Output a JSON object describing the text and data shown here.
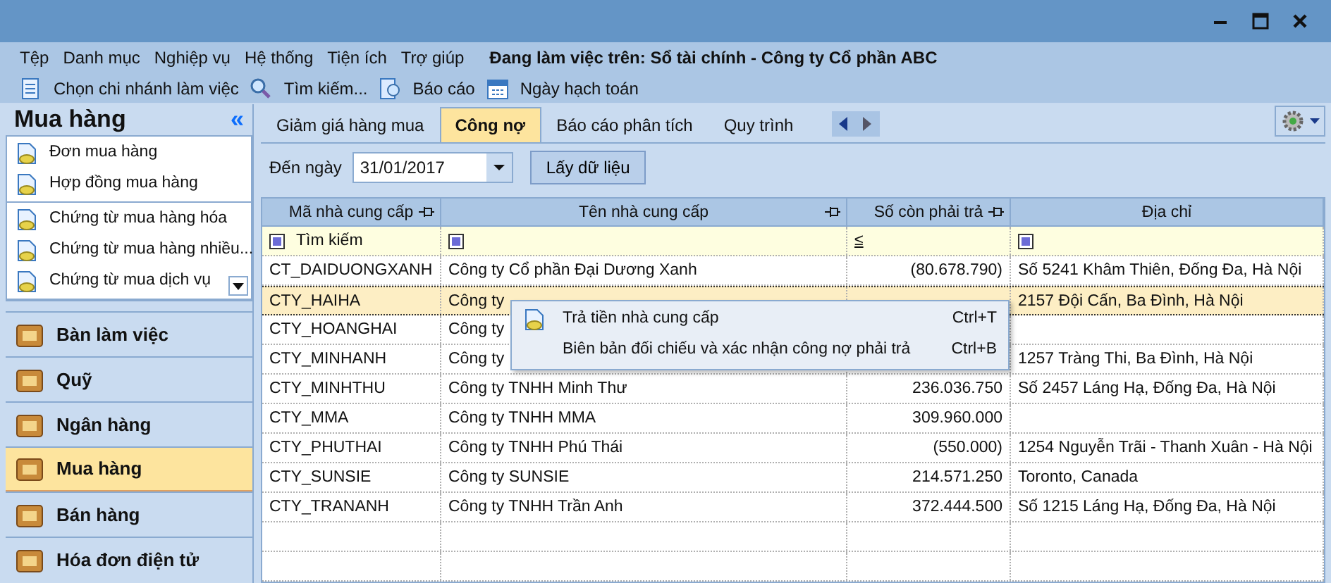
{
  "menu": [
    "Tệp",
    "Danh mục",
    "Nghiệp vụ",
    "Hệ thống",
    "Tiện ích",
    "Trợ giúp"
  ],
  "working_on": "Đang làm việc trên: Sổ tài chính - Công ty Cổ phần ABC",
  "toolbar": [
    {
      "kind": "document",
      "label": "Chọn chi nhánh làm việc"
    },
    {
      "kind": "search",
      "label": "Tìm kiếm..."
    },
    {
      "kind": "report",
      "label": "Báo cáo"
    },
    {
      "kind": "calendar",
      "label": "Ngày hạch toán"
    }
  ],
  "sidebar": {
    "title": "Mua hàng",
    "collapse": "«",
    "groups": [
      [
        "Đơn mua hàng",
        "Hợp đồng mua hàng"
      ],
      [
        "Chứng từ mua hàng hóa",
        "Chứng từ mua hàng nhiều...",
        "Chứng từ mua dịch vụ"
      ]
    ],
    "nav": [
      {
        "label": "Bàn làm việc",
        "selected": false
      },
      {
        "label": "Quỹ",
        "selected": false
      },
      {
        "label": "Ngân hàng",
        "selected": false
      },
      {
        "label": "Mua hàng",
        "selected": true
      },
      {
        "label": "Bán hàng",
        "selected": false
      },
      {
        "label": "Hóa đơn điện tử",
        "selected": false
      }
    ]
  },
  "tabs": [
    {
      "label": "Giảm giá hàng mua",
      "selected": false
    },
    {
      "label": "Công nợ",
      "selected": true
    },
    {
      "label": "Báo cáo phân tích",
      "selected": false
    },
    {
      "label": "Quy trình",
      "selected": false
    }
  ],
  "filter": {
    "label": "Đến ngày",
    "value": "31/01/2017",
    "button": "Lấy dữ liệu"
  },
  "table": {
    "columns": [
      {
        "label": "Mã nhà cung cấp",
        "pinned": true
      },
      {
        "label": "Tên nhà cung cấp",
        "pinned": true
      },
      {
        "label": "Số còn phải trả",
        "pinned": true
      },
      {
        "label": "Địa chỉ",
        "pinned": false
      }
    ],
    "search_row": {
      "placeholder": "Tìm kiếm",
      "operator": "≤"
    },
    "rows": [
      {
        "cells": [
          "CT_DAIDUONGXANH",
          "Công ty Cổ phần Đại Dương Xanh",
          "(80.678.790)",
          "Số 5241 Khâm Thiên, Đống Đa, Hà Nội"
        ],
        "selected": false
      },
      {
        "cells": [
          "CTY_HAIHA",
          "Công ty",
          "",
          "2157 Đội Cấn, Ba Đình, Hà Nội"
        ],
        "selected": true
      },
      {
        "cells": [
          "CTY_HOANGHAI",
          "Công ty",
          "",
          ""
        ],
        "selected": false
      },
      {
        "cells": [
          "CTY_MINHANH",
          "Công ty",
          "",
          "1257 Tràng Thi, Ba Đình, Hà Nội"
        ],
        "selected": false
      },
      {
        "cells": [
          "CTY_MINHTHU",
          "Công ty TNHH Minh Thư",
          "236.036.750",
          "Số 2457 Láng Hạ, Đống Đa, Hà Nội"
        ],
        "selected": false
      },
      {
        "cells": [
          "CTY_MMA",
          "Công ty TNHH MMA",
          "309.960.000",
          ""
        ],
        "selected": false
      },
      {
        "cells": [
          "CTY_PHUTHAI",
          "Công ty TNHH Phú Thái",
          "(550.000)",
          "1254 Nguyễn Trãi - Thanh Xuân - Hà Nội"
        ],
        "selected": false
      },
      {
        "cells": [
          "CTY_SUNSIE",
          "Công ty SUNSIE",
          "214.571.250",
          "Toronto, Canada"
        ],
        "selected": false
      },
      {
        "cells": [
          "CTY_TRANANH",
          "Công ty TNHH Trần Anh",
          "372.444.500",
          "Số 1215 Láng Hạ, Đống Đa, Hà Nội"
        ],
        "selected": false
      }
    ]
  },
  "context_menu": [
    {
      "label": "Trả tiền nhà cung cấp",
      "shortcut": "Ctrl+T",
      "has_icon": true
    },
    {
      "label": "Biên bản đối chiếu và xác nhận công nợ phải trả",
      "shortcut": "Ctrl+B",
      "has_icon": false
    }
  ]
}
